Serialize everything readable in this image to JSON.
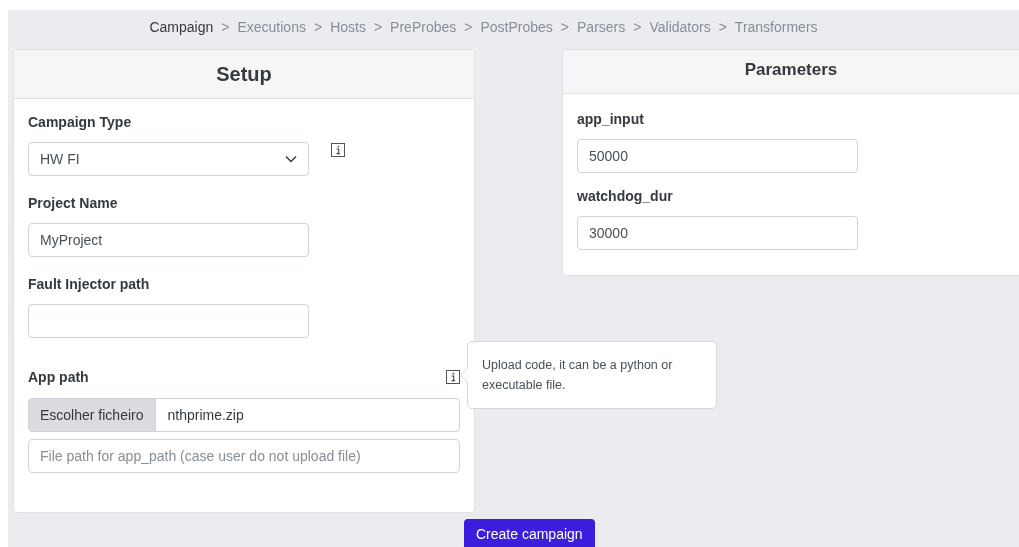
{
  "breadcrumb_separator": ">",
  "breadcrumb": [
    {
      "label": "Campaign",
      "selected": true
    },
    {
      "label": "Executions",
      "selected": false
    },
    {
      "label": "Hosts",
      "selected": false
    },
    {
      "label": "PreProbes",
      "selected": false
    },
    {
      "label": "PostProbes",
      "selected": false
    },
    {
      "label": "Parsers",
      "selected": false
    },
    {
      "label": "Validators",
      "selected": false
    },
    {
      "label": "Transformers",
      "selected": false
    }
  ],
  "setup": {
    "title": "Setup",
    "fields": [
      {
        "kind": "select",
        "label": "Campaign Type",
        "value": "HW FI",
        "info_icon": true
      },
      {
        "kind": "text",
        "label": "Project Name",
        "value": "MyProject",
        "info_icon": false
      },
      {
        "kind": "text",
        "label": "Fault Injector path",
        "info_icon": false
      },
      {
        "kind": "file",
        "label": "App path",
        "button": "Escolher ficheiro",
        "file_name": "nthprime.zip",
        "placeholder": "File path for app_path (case user do not upload file)",
        "info_icon": true
      }
    ]
  },
  "tooltip": {
    "text": "Upload code, it can be a python or executable file."
  },
  "parameters": {
    "title": "Parameters",
    "fields": [
      {
        "label": "app_input",
        "value": "50000"
      },
      {
        "label": "watchdog_dur",
        "value": "30000"
      }
    ]
  },
  "create_button": "Create campaign"
}
